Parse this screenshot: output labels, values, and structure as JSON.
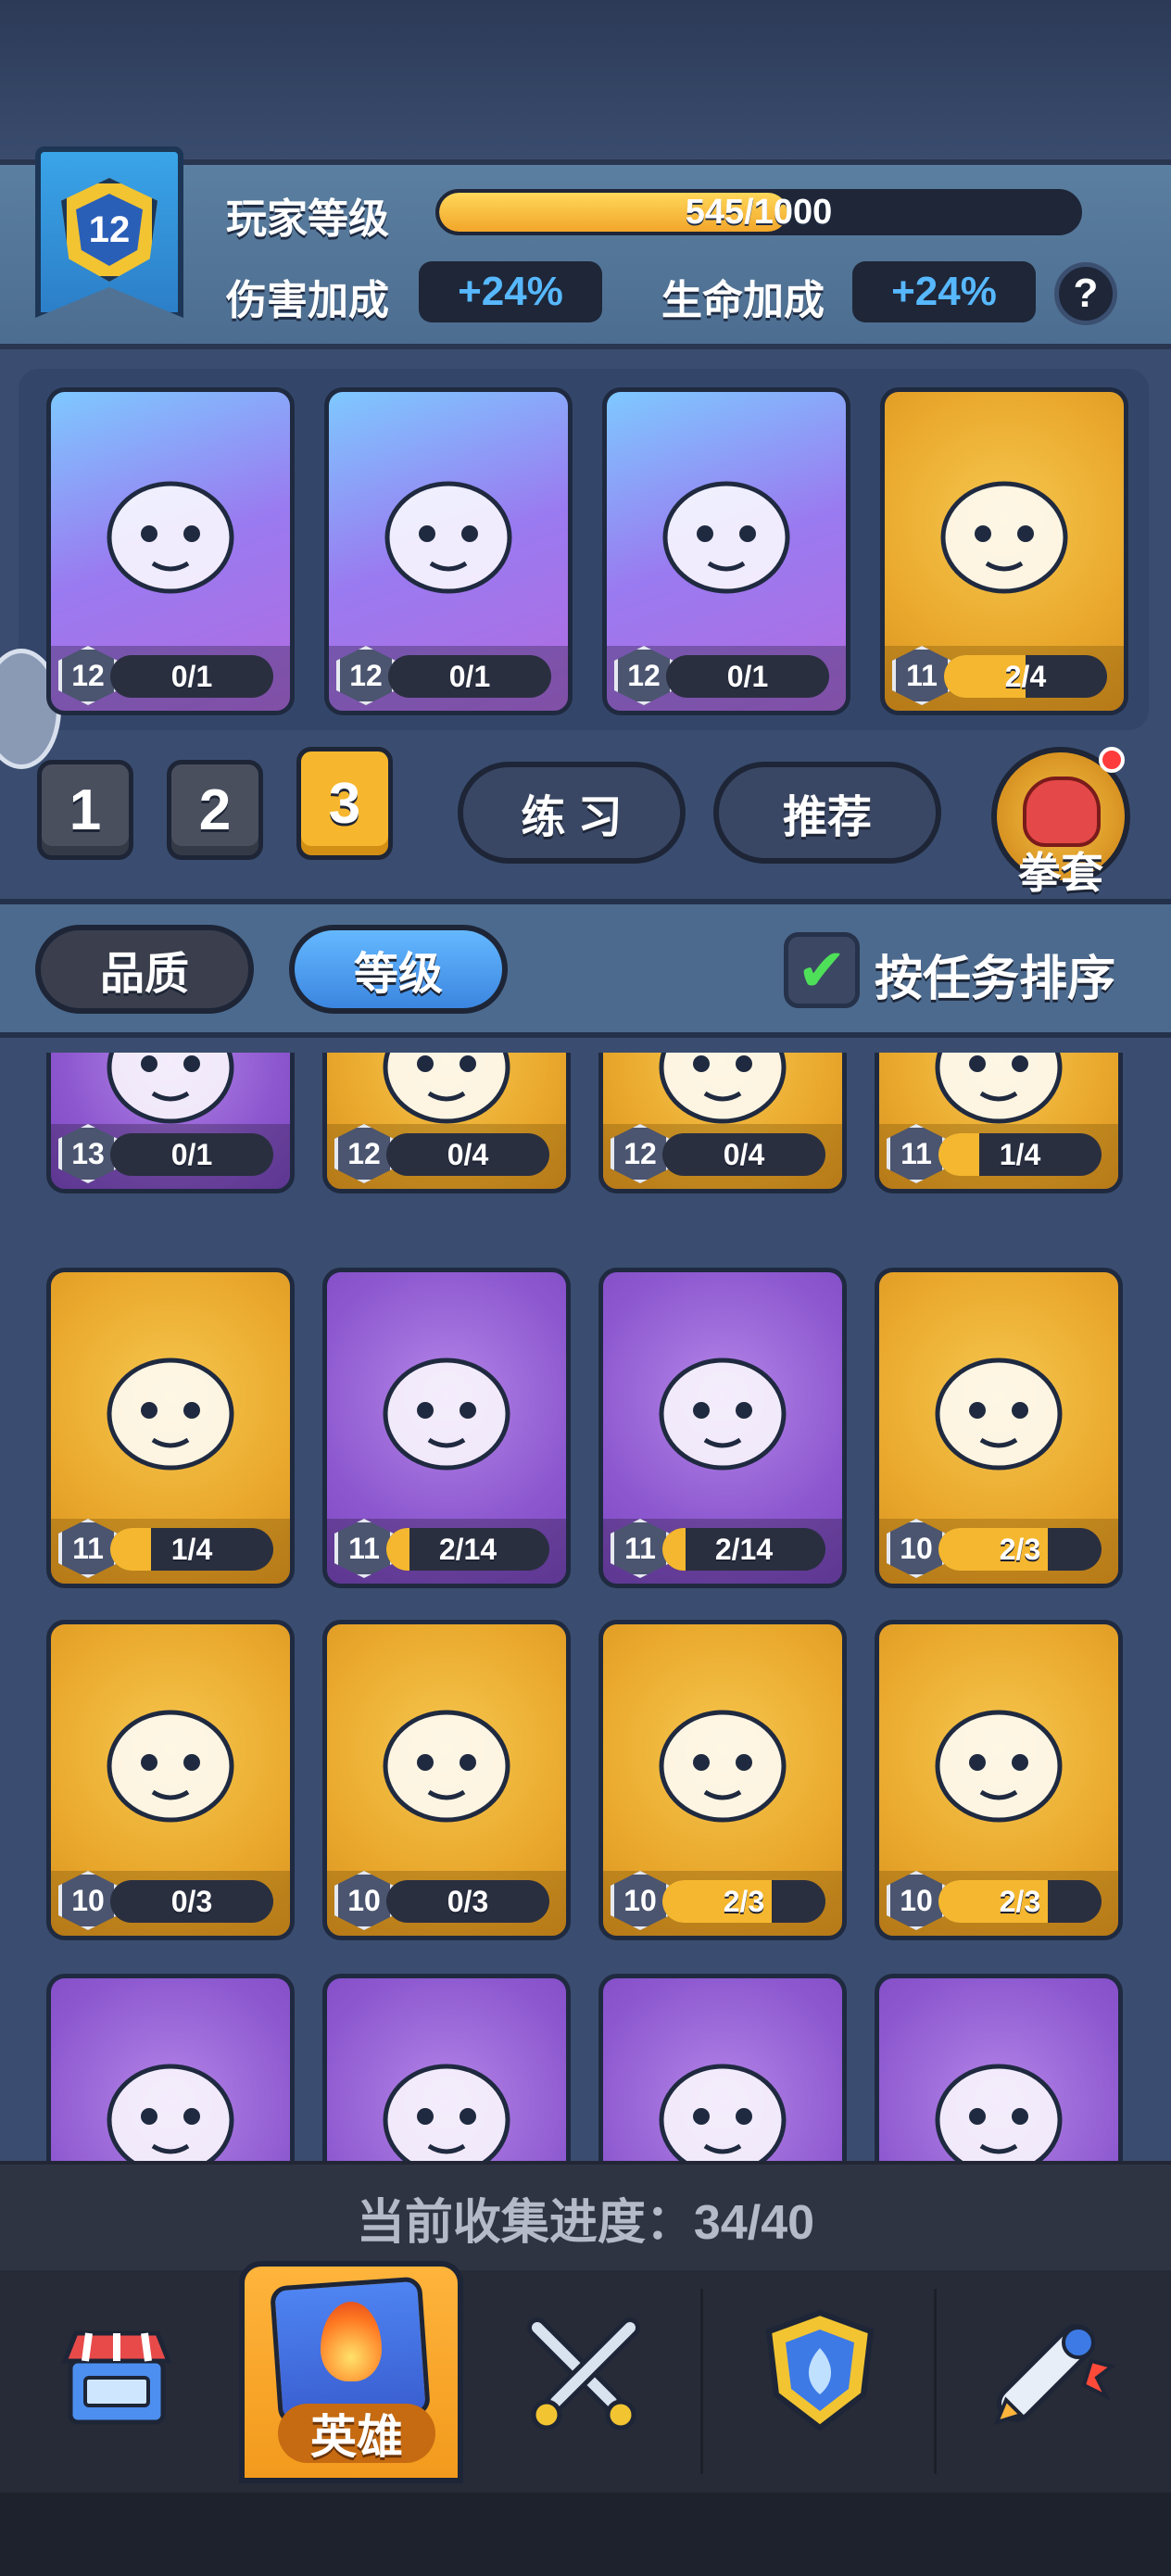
{
  "player": {
    "level": "12",
    "level_label": "玩家等级",
    "xp_text": "545/1000",
    "xp_fraction": 0.545,
    "damage_label": "伤害加成",
    "damage_value": "+24%",
    "hp_label": "生命加成",
    "hp_value": "+24%",
    "help": "?"
  },
  "team": [
    {
      "name": "teal-warrior",
      "color": "blue",
      "level": "12",
      "progress": "0/1",
      "fraction": 0
    },
    {
      "name": "panda-fighter",
      "color": "blue",
      "level": "12",
      "progress": "0/1",
      "fraction": 0
    },
    {
      "name": "red-chef-frog",
      "color": "blue",
      "level": "12",
      "progress": "0/1",
      "fraction": 0
    },
    {
      "name": "white-fox-mage",
      "color": "gold",
      "level": "11",
      "progress": "2/4",
      "fraction": 0.5
    }
  ],
  "team_tabs": [
    "1",
    "2",
    "3"
  ],
  "team_tabs_active": 2,
  "buttons": {
    "practice": "练 习",
    "recommend": "推荐",
    "glove": "拳套"
  },
  "sort": {
    "quality": "品质",
    "level": "等级",
    "active": "level",
    "task_sort_label": "按任务排序",
    "task_sort_checked": true,
    "check": "✔"
  },
  "heroes": [
    {
      "name": "blonde-knight",
      "color": "purple",
      "level": "13",
      "progress": "0/1",
      "fraction": 0
    },
    {
      "name": "purple-spider",
      "color": "gold",
      "level": "12",
      "progress": "0/4",
      "fraction": 0
    },
    {
      "name": "old-wizard",
      "color": "gold",
      "level": "12",
      "progress": "0/4",
      "fraction": 0
    },
    {
      "name": "crown-kid",
      "color": "gold",
      "level": "11",
      "progress": "1/4",
      "fraction": 0.25
    },
    {
      "name": "pink-cat-girl",
      "color": "gold",
      "level": "11",
      "progress": "1/4",
      "fraction": 0.25
    },
    {
      "name": "tiger-pirate",
      "color": "purple",
      "level": "11",
      "progress": "2/14",
      "fraction": 0.14
    },
    {
      "name": "ice-cat-girl",
      "color": "purple",
      "level": "11",
      "progress": "2/14",
      "fraction": 0.14
    },
    {
      "name": "masked-shaman",
      "color": "gold",
      "level": "10",
      "progress": "2/3",
      "fraction": 0.67
    },
    {
      "name": "shadow-imp",
      "color": "gold",
      "level": "10",
      "progress": "0/3",
      "fraction": 0
    },
    {
      "name": "vampire-lady",
      "color": "gold",
      "level": "10",
      "progress": "0/3",
      "fraction": 0
    },
    {
      "name": "cloud-spirit",
      "color": "gold",
      "level": "10",
      "progress": "2/3",
      "fraction": 0.67
    },
    {
      "name": "pig-bat",
      "color": "gold",
      "level": "10",
      "progress": "2/3",
      "fraction": 0.67
    },
    {
      "name": "zombie-brute",
      "color": "purple",
      "level": "",
      "progress": "",
      "fraction": 0
    },
    {
      "name": "old-yeti",
      "color": "purple",
      "level": "",
      "progress": "",
      "fraction": 0
    },
    {
      "name": "blue-slime",
      "color": "purple",
      "level": "",
      "progress": "",
      "fraction": 0
    },
    {
      "name": "straw-hat-ninja",
      "color": "purple",
      "level": "",
      "progress": "",
      "fraction": 0
    }
  ],
  "collection": {
    "text": "当前收集进度：34/40"
  },
  "nav": {
    "items": [
      "shop",
      "heroes",
      "battle",
      "clan",
      "events"
    ],
    "active": "heroes",
    "active_label": "英雄"
  },
  "colors": {
    "gold_card": "#e9a82c",
    "purple_card": "#8d58cf",
    "xp_fill": "#f5b72f",
    "accent_blue": "#57b8ff"
  }
}
